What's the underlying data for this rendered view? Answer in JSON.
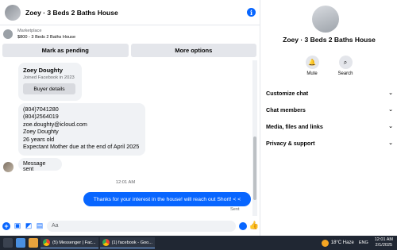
{
  "chat": {
    "title": "Zoey · 3 Beds 2 Baths House",
    "listing_label": "Marketplace",
    "listing_price": "$800 - 3 Beds 2 Baths House",
    "mark_pending": "Mark as pending",
    "more_options": "More options",
    "profile": {
      "name": "Zoey Doughty",
      "joined": "Joined Facebook in 2023",
      "buyer_details": "Buyer details"
    },
    "info_lines": [
      "(804)7041280",
      "(804)2564019",
      "zoe.doughty@icloud.com",
      "Zoey Doughty",
      "26 years old",
      "Expectant Mother due at the end of April 2025"
    ],
    "sent_message": "Message sent",
    "timestamp": "12:01 AM",
    "outgoing": "Thanks for your interest in the house! will reach out Short! < <",
    "delivery": "Sent",
    "composer_placeholder": "Aa"
  },
  "details": {
    "title": "Zoey · 3 Beds 2 Baths House",
    "mute": "Mute",
    "search": "Search",
    "rows": [
      "Customize chat",
      "Chat members",
      "Media, files and links",
      "Privacy & support"
    ]
  },
  "taskbar": {
    "task1": "(5) Messenger | Fac...",
    "task2": "(1) facebook - Goo...",
    "weather": "18°C  Haze",
    "lang": "ENG",
    "time": "12:01 AM",
    "date": "2/1/2025"
  },
  "icons": [
    "info-icon",
    "plus-icon",
    "image-icon",
    "sticker-icon",
    "gif-icon",
    "emoji-icon",
    "like-icon",
    "bell-icon",
    "search-icon",
    "chevron-down-icon"
  ],
  "colors": {
    "accent": "#0866ff",
    "bubble_grey": "#f0f2f5",
    "taskbar": "#202733"
  }
}
